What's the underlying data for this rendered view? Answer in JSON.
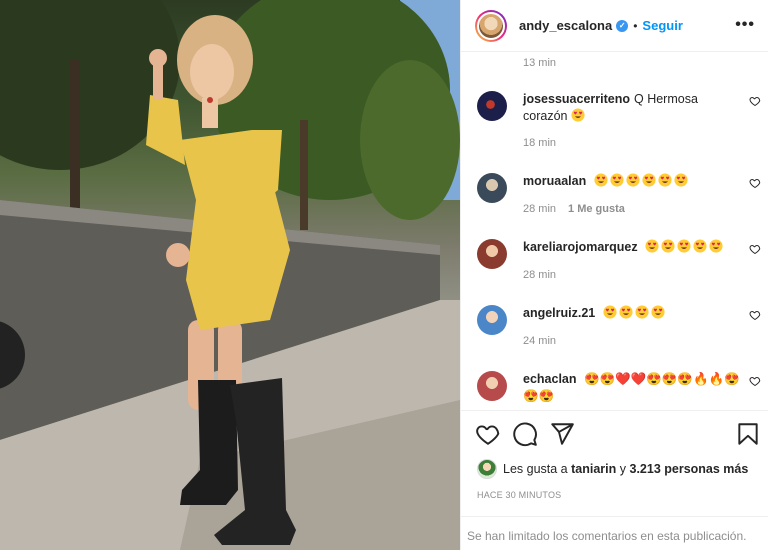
{
  "post": {
    "image_alt": "Mujer con vestido amarillo floreado y botas negras",
    "username": "andy_escalona",
    "verified": true,
    "separator": "•",
    "follow_label": "Seguir",
    "more_label": "•••"
  },
  "comments": {
    "top_timestamp": "13 min",
    "items": [
      {
        "user": "josessuacerriteno",
        "text": "Q Hermosa corazón",
        "emoji_count": 1,
        "time": "18 min",
        "likes": "",
        "avatar_color": "#1c1f4a"
      },
      {
        "user": "moruaalan",
        "text": "",
        "emoji_count": 6,
        "time": "28 min",
        "likes": "1 Me gusta",
        "avatar_color": "#3b4a5a"
      },
      {
        "user": "kareliarojomarquez",
        "text": "",
        "emoji_count": 5,
        "time": "28 min",
        "likes": "",
        "avatar_color": "#8a3b2e"
      },
      {
        "user": "angelruiz.21",
        "text": "",
        "emoji_count": 4,
        "time": "24 min",
        "likes": "",
        "avatar_color": "#4a86c8"
      },
      {
        "user": "echaclan",
        "text": "",
        "emoji_sequence": "😍😍❤️❤️😍😍😍🔥🔥😍😍😍",
        "time": "",
        "likes": "",
        "avatar_color": "#b74a4a"
      }
    ]
  },
  "actions": {
    "like_icon": "heart-outline-icon",
    "comment_icon": "comment-icon",
    "share_icon": "paper-plane-icon",
    "save_icon": "bookmark-icon"
  },
  "likes": {
    "prefix": "Les gusta a",
    "user": "taniarin",
    "connector": "y",
    "others": "3.213 personas más"
  },
  "posted_ago": "HACE 30 MINUTOS",
  "comments_limited": "Se han limitado los comentarios en esta publicación.",
  "colors": {
    "accent": "#0095f6",
    "muted": "#8e8e8e",
    "text": "#262626",
    "dress": "#e8c54a"
  }
}
